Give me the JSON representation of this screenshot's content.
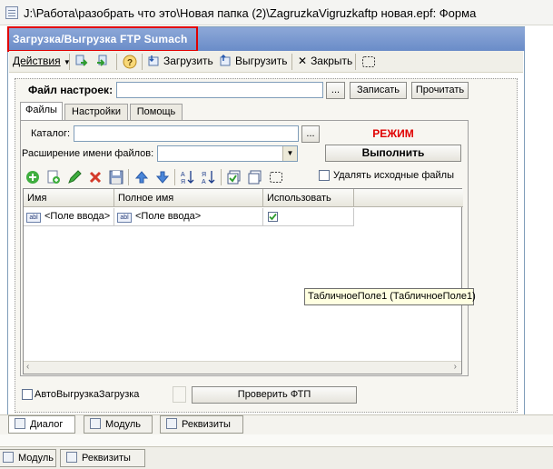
{
  "window": {
    "title": "J:\\Работа\\разобрать что это\\Новая папка (2)\\ZagruzkaVigruzkaftp новая.epf: Форма"
  },
  "form": {
    "title": "Загрузка/Выгрузка FTP Sumach"
  },
  "toolbar": {
    "actions_label": "Действия",
    "upload_label": "Загрузить",
    "download_label": "Выгрузить",
    "close_label": "Закрыть"
  },
  "settings": {
    "file_label": "Файл настроек:",
    "file_value": "",
    "browse_label": "...",
    "save_label": "Записать",
    "read_label": "Прочитать"
  },
  "tabs": [
    "Файлы",
    "Настройки",
    "Помощь"
  ],
  "files_tab": {
    "catalog_label": "Каталог:",
    "catalog_value": "",
    "browse_label": "...",
    "mode_label": "РЕЖИМ",
    "ext_label": "Расширение имени файлов:",
    "ext_value": "",
    "execute_label": "Выполнить",
    "delete_source_label": "Удалять исходные файлы"
  },
  "table": {
    "columns": [
      "Имя",
      "Полное имя",
      "Использовать"
    ],
    "rows": [
      {
        "name": "<Поле ввода>",
        "full_name": "<Поле ввода>",
        "use": true
      }
    ],
    "tooltip": "ТабличноеПоле1 (ТабличноеПоле1)"
  },
  "bottom": {
    "auto_label": "АвтоВыгрузкаЗагрузка",
    "check_ftp_label": "Проверить ФТП"
  },
  "designer_tabs": [
    "Диалог",
    "Модуль",
    "Реквизиты"
  ],
  "outer_tabs": [
    "Модуль",
    "Реквизиты"
  ],
  "colors": {
    "form_title_bg": "#7a98d0",
    "mode_text": "#e00000",
    "highlight": "#e00000"
  }
}
